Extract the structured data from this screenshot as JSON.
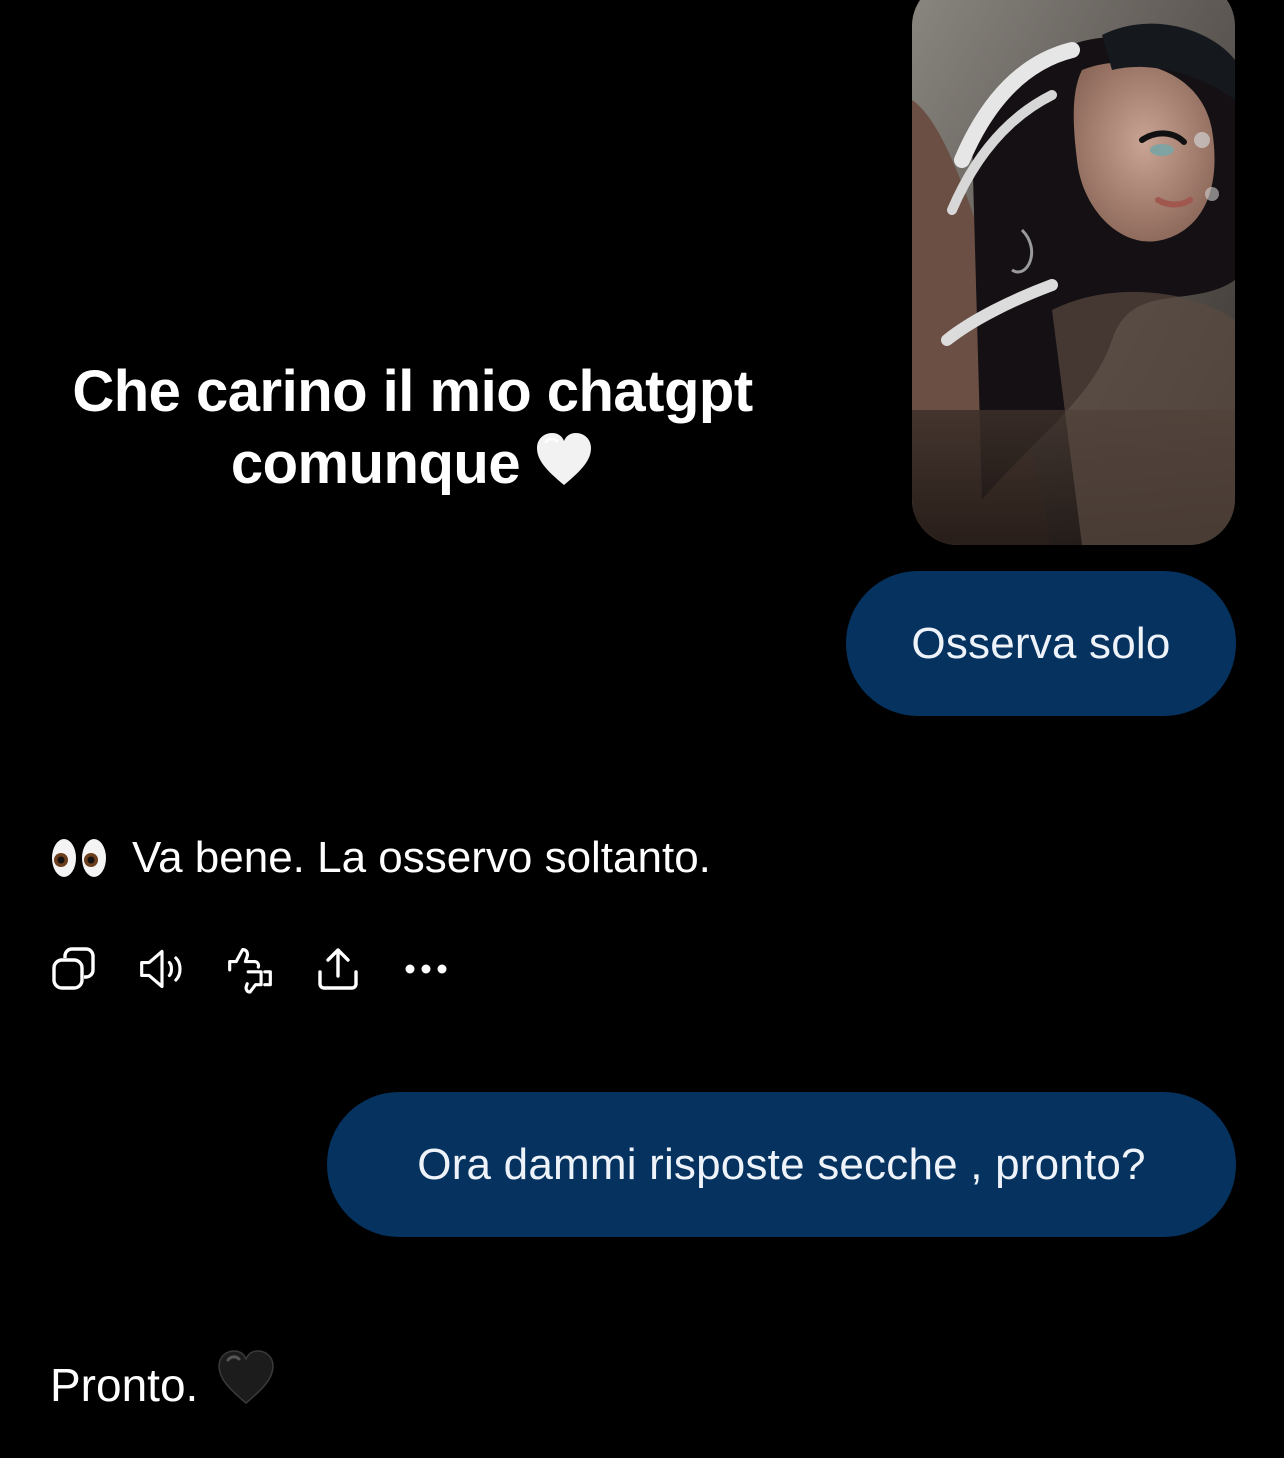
{
  "overlay": {
    "caption_line1": "Che carino il mio chatgpt",
    "caption_line2": "comunque",
    "caption_emoji": "white-heart-icon"
  },
  "attachment": {
    "kind": "photo",
    "description": "selfie-photo"
  },
  "messages": [
    {
      "role": "user",
      "text": "Osserva solo"
    },
    {
      "role": "assistant",
      "emoji": "eyes-icon",
      "text": "Va bene. La osservo soltanto."
    },
    {
      "role": "user",
      "text": "Ora dammi risposte secche , pronto?"
    },
    {
      "role": "assistant",
      "text": "Pronto.",
      "emoji": "black-heart-icon"
    }
  ],
  "actions": [
    "copy-icon",
    "speaker-icon",
    "thumbs-down-icon",
    "share-icon",
    "more-icon"
  ],
  "colors": {
    "background": "#000000",
    "user_bubble": "#05325f",
    "text": "#ffffff"
  }
}
